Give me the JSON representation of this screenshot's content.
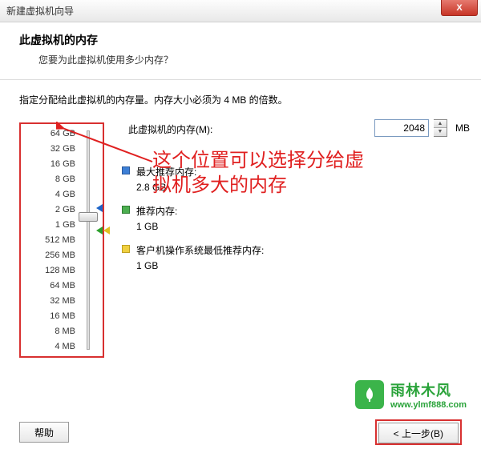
{
  "window": {
    "title": "新建虚拟机向导",
    "close": "X"
  },
  "header": {
    "title": "此虚拟机的内存",
    "subtitle": "您要为此虚拟机使用多少内存？"
  },
  "instruction": "指定分配给此虚拟机的内存量。内存大小必须为 4 MB 的倍数。",
  "slider": {
    "labels": [
      "64 GB",
      "32 GB",
      "16 GB",
      "8 GB",
      "4 GB",
      "2 GB",
      "1 GB",
      "512 MB",
      "256 MB",
      "128 MB",
      "64 MB",
      "32 MB",
      "16 MB",
      "8 MB",
      "4 MB"
    ]
  },
  "memory": {
    "label": "此虚拟机的内存(M):",
    "value": "2048",
    "unit": "MB"
  },
  "recommendations": {
    "max_label": "最大推荐内存:",
    "max_value": "2.8 GB",
    "rec_label": "推荐内存:",
    "rec_value": "1 GB",
    "min_label": "客户机操作系统最低推荐内存:",
    "min_value": "1 GB"
  },
  "annotation": {
    "line1": "这个位置可以选择分给虚",
    "line2": "拟机多大的内存"
  },
  "footer": {
    "help": "帮助",
    "back": "< 上一步(B)"
  },
  "watermark": {
    "name": "雨林木风",
    "url": "www.ylmf888.com"
  }
}
